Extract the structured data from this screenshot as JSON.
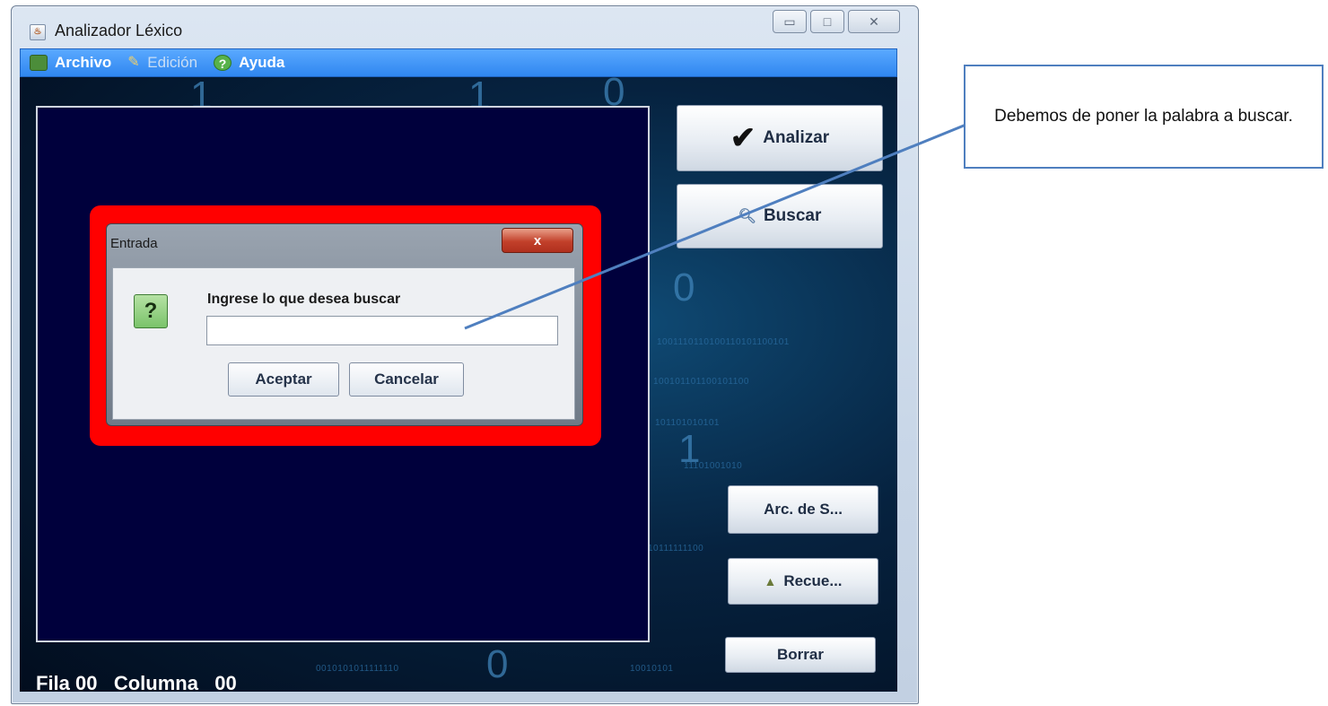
{
  "window": {
    "title": "Analizador Léxico",
    "controls": {
      "minimize": "▭",
      "maximize": "□",
      "close": "✕"
    }
  },
  "menu": {
    "items": [
      {
        "label": "Archivo",
        "icon": "folder-icon"
      },
      {
        "label": "Edición",
        "icon": "pencil-icon"
      },
      {
        "label": "Ayuda",
        "icon": "help-icon"
      }
    ]
  },
  "side_buttons": {
    "analizar": "Analizar",
    "buscar": "Buscar",
    "arc": "Arc. de S...",
    "recue": "Recue...",
    "borrar": "Borrar"
  },
  "status": {
    "text": "Fila 00   Columna   00"
  },
  "dialog": {
    "title": "Entrada",
    "close": "x",
    "icon": "?",
    "prompt": "Ingrese lo que desea buscar",
    "input_value": "",
    "accept": "Aceptar",
    "cancel": "Cancelar"
  },
  "callout": {
    "text": "Debemos de poner la palabra a buscar."
  },
  "colors": {
    "highlight": "#ff0000",
    "menubar": "#3b8ff5",
    "text_area": "#00003c",
    "callout_border": "#4f7fbf"
  }
}
